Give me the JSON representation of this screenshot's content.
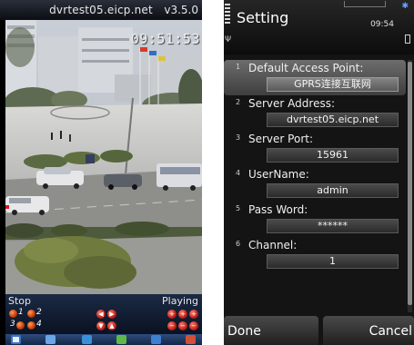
{
  "viewer": {
    "host": "dvrtest05.eicp.net",
    "version": "v3.5.0",
    "timestamp": "09:51:53",
    "status_left": "Stop",
    "status_right": "Playing",
    "channels": [
      "1",
      "2",
      "3",
      "4"
    ]
  },
  "settings": {
    "title": "Setting",
    "clock": "09:54",
    "fields": [
      {
        "index": "1",
        "label": "Default Access Point:",
        "value": "GPRS连接互联网"
      },
      {
        "index": "2",
        "label": "Server Address:",
        "value": "dvrtest05.eicp.net"
      },
      {
        "index": "3",
        "label": "Server Port:",
        "value": "15961"
      },
      {
        "index": "4",
        "label": "UserName:",
        "value": "admin"
      },
      {
        "index": "5",
        "label": "Pass Word:",
        "value": "******"
      },
      {
        "index": "6",
        "label": "Channel:",
        "value": "1"
      }
    ],
    "softkeys": {
      "left": "Done",
      "right": "Cancel"
    }
  },
  "colors": {
    "titlebar": "#0b0d12",
    "control_bar": "#1b2a44",
    "channel_dot": "#c23b08",
    "settings_bg": "#141414",
    "selected_row": "#6d6d6d"
  }
}
